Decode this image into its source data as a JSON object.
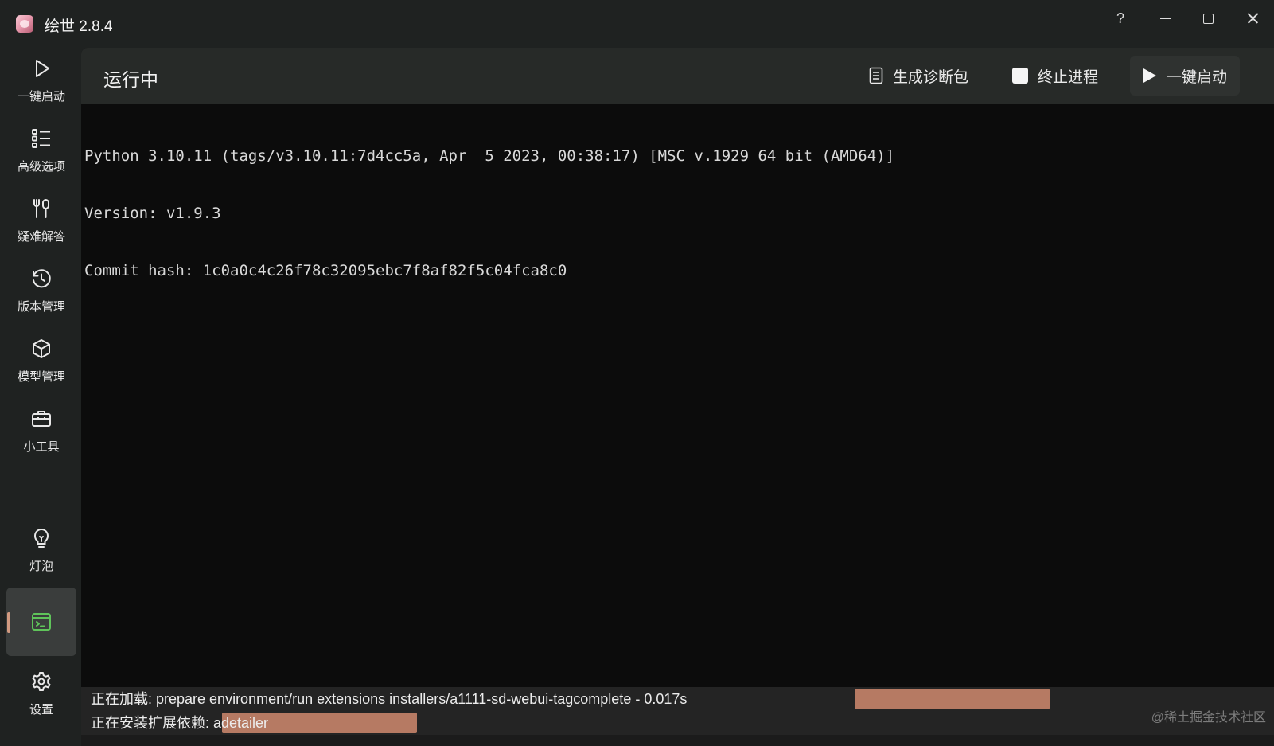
{
  "window": {
    "title": "绘世 2.8.4",
    "help_symbol": "?"
  },
  "sidebar": {
    "items": [
      {
        "label": "一键启动",
        "icon": "play-outline-icon"
      },
      {
        "label": "高级选项",
        "icon": "list-settings-icon"
      },
      {
        "label": "疑难解答",
        "icon": "tools-icon"
      },
      {
        "label": "版本管理",
        "icon": "history-icon"
      },
      {
        "label": "模型管理",
        "icon": "cube-icon"
      },
      {
        "label": "小工具",
        "icon": "toolbox-icon"
      },
      {
        "label": "灯泡",
        "icon": "lightbulb-icon"
      },
      {
        "label": "",
        "icon": "terminal-icon",
        "active": true
      },
      {
        "label": "设置",
        "icon": "gear-icon"
      }
    ]
  },
  "header": {
    "title": "运行中",
    "diag_label": "生成诊断包",
    "stop_label": "终止进程",
    "launch_label": "一键启动"
  },
  "console": {
    "lines": [
      "Python 3.10.11 (tags/v3.10.11:7d4cc5a, Apr  5 2023, 00:38:17) [MSC v.1929 64 bit (AMD64)]",
      "Version: v1.9.3",
      "Commit hash: 1c0a0c4c26f78c32095ebc7f8af82f5c04fca8c0"
    ]
  },
  "status": {
    "loading_text": "正在加载: prepare environment/run extensions installers/a1111-sd-webui-tagcomplete - 0.017s",
    "loading_progress": 0.66,
    "install_text": "正在安装扩展依赖: adetailer",
    "install_progress": 0.28
  },
  "watermark": "@稀土掘金技术社区",
  "colors": {
    "accent": "#d29a80",
    "progress": "#d08a6e",
    "terminal_icon": "#5fc45a",
    "background": "#1f2221",
    "console_bg": "#0c0c0c"
  }
}
